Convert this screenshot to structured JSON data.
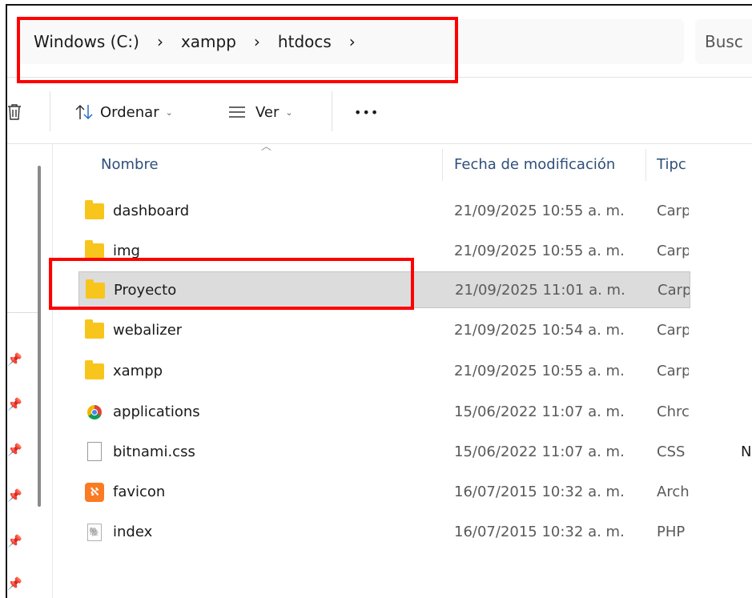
{
  "breadcrumb": [
    "Windows (C:)",
    "xampp",
    "htdocs"
  ],
  "search": {
    "label": "Busc"
  },
  "toolbar": {
    "sort_label": "Ordenar",
    "view_label": "Ver",
    "more_label": "•••"
  },
  "columns": {
    "name": "Nombre",
    "date": "Fecha de modificación",
    "type": "Tipc"
  },
  "files": [
    {
      "name": "dashboard",
      "date": "21/09/2025 10:55 a. m.",
      "type": "Carp",
      "icon": "folder-icon"
    },
    {
      "name": "img",
      "date": "21/09/2025 10:55 a. m.",
      "type": "Carp",
      "icon": "folder-icon"
    },
    {
      "name": "Proyecto",
      "date": "21/09/2025 11:01 a. m.",
      "type": "Carp",
      "icon": "folder-icon",
      "selected": true
    },
    {
      "name": "webalizer",
      "date": "21/09/2025 10:54 a. m.",
      "type": "Carp",
      "icon": "folder-icon"
    },
    {
      "name": "xampp",
      "date": "21/09/2025 10:55 a. m.",
      "type": "Carp",
      "icon": "folder-icon"
    },
    {
      "name": "applications",
      "date": "15/06/2022 11:07 a. m.",
      "type": "Chrc",
      "icon": "chrome-icon"
    },
    {
      "name": "bitnami.css",
      "date": "15/06/2022 11:07 a. m.",
      "type": "CSS",
      "icon": "document-icon",
      "extra": "N"
    },
    {
      "name": "favicon",
      "date": "16/07/2015 10:32 a. m.",
      "type": "Arch",
      "icon": "xampp-icon"
    },
    {
      "name": "index",
      "date": "16/07/2015 10:32 a. m.",
      "type": "PHP",
      "icon": "php-icon"
    }
  ],
  "colors": {
    "highlight": "#ff0000",
    "folder": "#f8c51c",
    "selected_row": "#dcdcdc"
  }
}
